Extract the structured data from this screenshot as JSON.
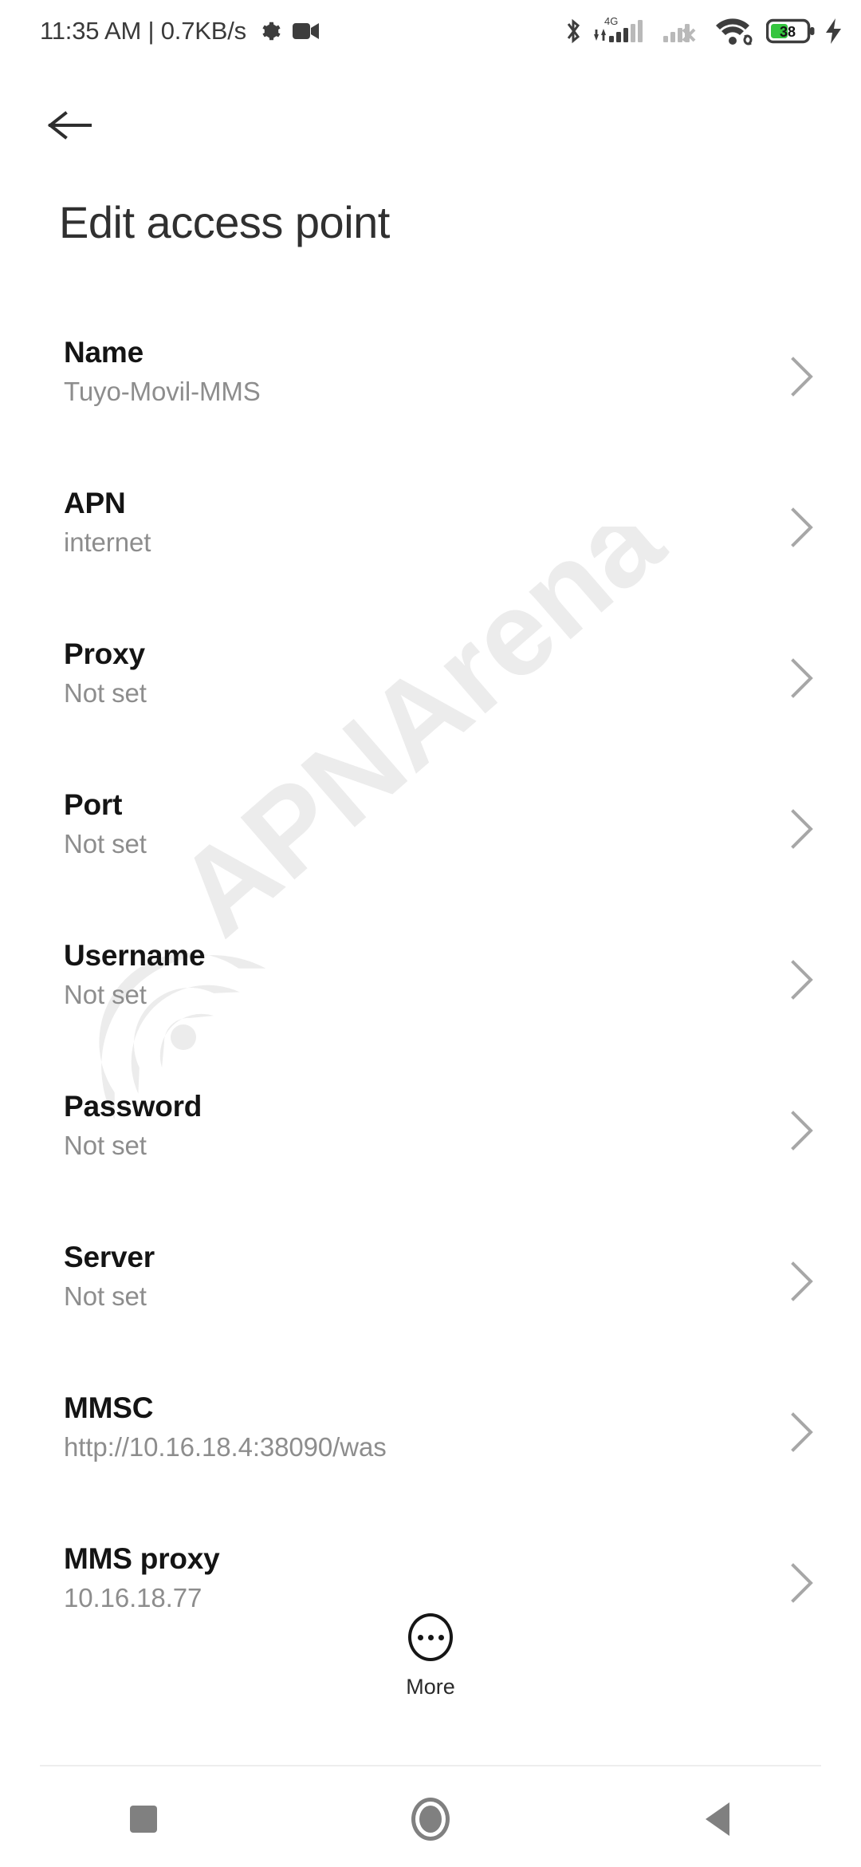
{
  "status_bar": {
    "clock": "11:35 AM | 0.7KB/s",
    "left_icons": [
      "gear-icon",
      "video-camera-icon"
    ],
    "right_icons": [
      "bluetooth-icon",
      "signal-4g-icon",
      "signal-no-service-icon",
      "wifi-icon",
      "battery-icon",
      "charging-bolt-icon"
    ],
    "network_type": "4G",
    "battery_percent": "38",
    "battery_fill_color": "#35c53f",
    "icon_color": "#3d3d3d",
    "signal_dim_color": "#b9b9b9"
  },
  "header": {
    "back_icon": "arrow-left-icon",
    "title": "Edit access point"
  },
  "list": {
    "chevron_icon": "chevron-right-icon",
    "rows": [
      {
        "label": "Name",
        "value": "Tuyo-Movil-MMS"
      },
      {
        "label": "APN",
        "value": "internet"
      },
      {
        "label": "Proxy",
        "value": "Not set"
      },
      {
        "label": "Port",
        "value": "Not set"
      },
      {
        "label": "Username",
        "value": "Not set"
      },
      {
        "label": "Password",
        "value": "Not set"
      },
      {
        "label": "Server",
        "value": "Not set"
      },
      {
        "label": "MMSC",
        "value": "http://10.16.18.4:38090/was"
      },
      {
        "label": "MMS proxy",
        "value": "10.16.18.77"
      }
    ]
  },
  "more_button": {
    "icon": "more-dots-circle-icon",
    "label": "More"
  },
  "watermark": {
    "text": "APNArena",
    "icon": "wifi-arc-icon",
    "color": "#ececec"
  },
  "nav_bar": {
    "recents_icon": "square-recents-icon",
    "home_icon": "circle-home-icon",
    "back_icon": "triangle-back-icon",
    "icon_color": "#808080"
  }
}
